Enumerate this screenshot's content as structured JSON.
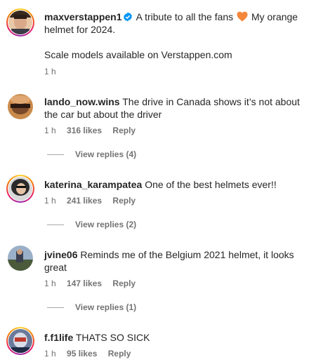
{
  "post": {
    "username": "maxverstappen1",
    "caption_line1": "A tribute to all the fans",
    "caption_line1_after": "My orange",
    "caption_line2": "helmet for 2024.",
    "caption_line3": "Scale models available on Verstappen.com",
    "time": "1 h",
    "verified_color": "#0095f6",
    "heart_color": "#f5873a"
  },
  "comments": [
    {
      "username": "lando_now.wins",
      "text": "The drive in Canada shows it’s not about the car but about the driver",
      "time": "1 h",
      "likes": "316 likes",
      "reply": "Reply",
      "view_replies": "View replies (4)"
    },
    {
      "username": "katerina_karampatea",
      "text": "One of the best helmets ever!!",
      "time": "1 h",
      "likes": "241 likes",
      "reply": "Reply",
      "view_replies": "View replies (2)"
    },
    {
      "username": "jvine06",
      "text": "Reminds me of the Belgium 2021 helmet, it looks great",
      "time": "1 h",
      "likes": "147 likes",
      "reply": "Reply",
      "view_replies": "View replies (1)"
    },
    {
      "username": "f.f1life",
      "text": "THATS SO SICK",
      "time": "1 h",
      "likes": "95 likes",
      "reply": "Reply"
    }
  ]
}
